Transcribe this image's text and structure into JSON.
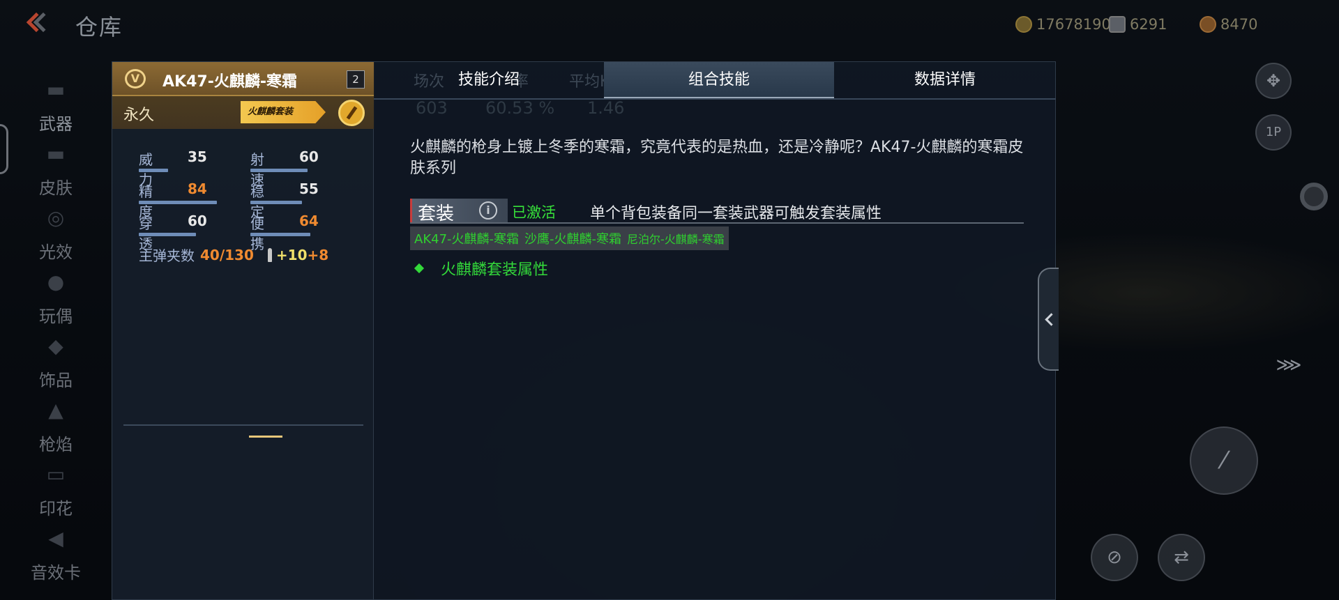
{
  "header": {
    "title": "仓库",
    "currencies": [
      {
        "icon": "gold-coin-icon",
        "value": "17678190"
      },
      {
        "icon": "diamond-icon",
        "value": "6291"
      },
      {
        "icon": "medal-icon",
        "value": "8470"
      }
    ]
  },
  "sidebar": {
    "items": [
      {
        "label": "武器",
        "icon": "rifle-icon"
      },
      {
        "label": "皮肤",
        "icon": "skin-icon"
      },
      {
        "label": "光效",
        "icon": "light-effect-icon"
      },
      {
        "label": "玩偶",
        "icon": "doll-icon"
      },
      {
        "label": "饰品",
        "icon": "ornament-icon"
      },
      {
        "label": "枪焰",
        "icon": "muzzle-flame-icon"
      },
      {
        "label": "印花",
        "icon": "decal-icon"
      },
      {
        "label": "音效卡",
        "icon": "sound-card-icon"
      }
    ]
  },
  "weapon": {
    "rank_glyph": "V",
    "name": "AK47-火麒麟-寒霜",
    "level": "2",
    "duration": "永久",
    "suit_tag": "火麒麟套装",
    "stats": [
      {
        "label": "威力",
        "value": "35"
      },
      {
        "label": "射速",
        "value": "60"
      },
      {
        "label": "精度",
        "value": "84"
      },
      {
        "label": "稳定",
        "value": "55"
      },
      {
        "label": "穿透",
        "value": "60"
      },
      {
        "label": "便携",
        "value": "64"
      }
    ],
    "ammo": {
      "label": "主弹夹数",
      "value": "40/130",
      "bonus1": "+10",
      "bonus2": "+8"
    }
  },
  "tabs": {
    "items": [
      "技能介绍",
      "组合技能",
      "数据详情"
    ],
    "active": "组合技能",
    "ghost_headers": [
      "场次",
      "率",
      "平均KDA"
    ],
    "ghost_values": [
      "603",
      "60.53 %",
      "1.46"
    ]
  },
  "detail": {
    "description": "火麒麟的枪身上镀上冬季的寒霜，究竟代表的是热血，还是冷静呢？AK47-火麒麟的寒霜皮肤系列",
    "suit_title": "套装",
    "suit_status": "已激活",
    "suit_desc": "单个背包装备同一套装武器可触发套装属性",
    "members": [
      "AK47-火麒麟-寒霜",
      "沙鹰-火麒麟-寒霜",
      "尼泊尔-火麒麟-寒霜"
    ],
    "attribute": "火麒麟套装属性"
  },
  "right_controls": {
    "view_label": "1P"
  }
}
